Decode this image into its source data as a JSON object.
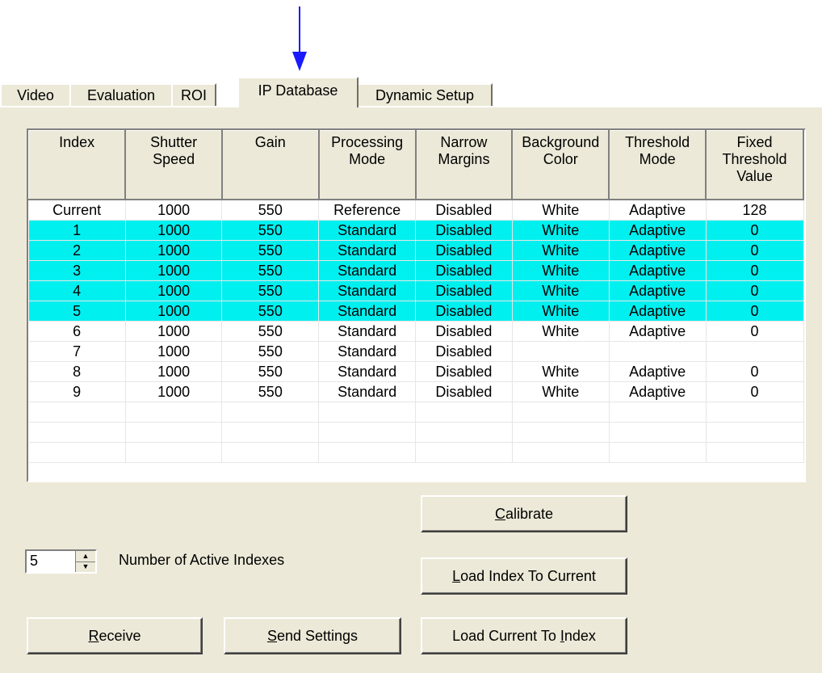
{
  "tabs": [
    "Video",
    "Evaluation",
    "ROI",
    "IP Database",
    "Dynamic Setup"
  ],
  "active_tab": "IP Database",
  "table": {
    "headers": [
      [
        "Index"
      ],
      [
        "Shutter",
        "Speed"
      ],
      [
        "Gain"
      ],
      [
        "Processing",
        "Mode"
      ],
      [
        "Narrow",
        "Margins"
      ],
      [
        "Background",
        "Color"
      ],
      [
        "Threshold",
        "Mode"
      ],
      [
        "Fixed",
        "Threshold",
        "Value"
      ]
    ],
    "rows": [
      {
        "cells": [
          "Current",
          "1000",
          "550",
          "Reference",
          "Disabled",
          "White",
          "Adaptive",
          "128"
        ],
        "selected": false
      },
      {
        "cells": [
          "1",
          "1000",
          "550",
          "Standard",
          "Disabled",
          "White",
          "Adaptive",
          "0"
        ],
        "selected": true
      },
      {
        "cells": [
          "2",
          "1000",
          "550",
          "Standard",
          "Disabled",
          "White",
          "Adaptive",
          "0"
        ],
        "selected": true
      },
      {
        "cells": [
          "3",
          "1000",
          "550",
          "Standard",
          "Disabled",
          "White",
          "Adaptive",
          "0"
        ],
        "selected": true
      },
      {
        "cells": [
          "4",
          "1000",
          "550",
          "Standard",
          "Disabled",
          "White",
          "Adaptive",
          "0"
        ],
        "selected": true
      },
      {
        "cells": [
          "5",
          "1000",
          "550",
          "Standard",
          "Disabled",
          "White",
          "Adaptive",
          "0"
        ],
        "selected": true
      },
      {
        "cells": [
          "6",
          "1000",
          "550",
          "Standard",
          "Disabled",
          "White",
          "Adaptive",
          "0"
        ],
        "selected": false
      },
      {
        "cells": [
          "7",
          "1000",
          "550",
          "Standard",
          "Disabled",
          "",
          "",
          ""
        ],
        "selected": false
      },
      {
        "cells": [
          "8",
          "1000",
          "550",
          "Standard",
          "Disabled",
          "White",
          "Adaptive",
          "0"
        ],
        "selected": false
      },
      {
        "cells": [
          "9",
          "1000",
          "550",
          "Standard",
          "Disabled",
          "White",
          "Adaptive",
          "0"
        ],
        "selected": false
      },
      {
        "cells": [
          "",
          "",
          "",
          "",
          "",
          "",
          "",
          ""
        ],
        "selected": false
      },
      {
        "cells": [
          "",
          "",
          "",
          "",
          "",
          "",
          "",
          ""
        ],
        "selected": false
      },
      {
        "cells": [
          "",
          "",
          "",
          "",
          "",
          "",
          "",
          ""
        ],
        "selected": false
      }
    ]
  },
  "active_indexes": {
    "value": "5",
    "label": "Number of Active Indexes"
  },
  "buttons": {
    "calibrate": {
      "pre": "",
      "u": "C",
      "post": "alibrate"
    },
    "load_index": {
      "pre": "",
      "u": "L",
      "post": "oad Index To Current"
    },
    "load_current": {
      "pre": "Load Current To ",
      "u": "I",
      "post": "ndex"
    },
    "receive": {
      "pre": "",
      "u": "R",
      "post": "eceive"
    },
    "send": {
      "pre": "",
      "u": "S",
      "post": "end Settings"
    }
  },
  "colors": {
    "highlight": "#00f0f0",
    "arrow": "#1a1aff",
    "face": "#ece9d8"
  }
}
